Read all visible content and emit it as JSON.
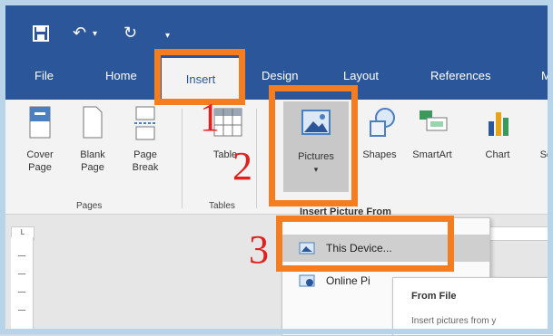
{
  "quick_access": {
    "save_icon": "save-icon",
    "undo_icon": "undo-icon",
    "redo_icon": "redo-icon",
    "customize_icon": "customize-qat-icon"
  },
  "tabs": [
    "File",
    "Home",
    "Insert",
    "Design",
    "Layout",
    "References",
    "M"
  ],
  "ribbon": {
    "pages": {
      "cover_page": "Cover Page",
      "blank_page": "Blank Page",
      "page_break": "Page Break",
      "group_label": "Pages"
    },
    "tables": {
      "table": "Table",
      "group_label": "Tables"
    },
    "illustrations": {
      "pictures": "Pictures",
      "shapes": "Shapes",
      "smartart": "SmartArt",
      "chart": "Chart",
      "screenshot": "Sc"
    }
  },
  "insert_picture_menu": {
    "title": "Insert Picture From",
    "items": [
      "This Device...",
      "Online Pi"
    ]
  },
  "tooltip": {
    "title": "From File",
    "body": "Insert pictures from y"
  },
  "annotations": {
    "step1": "1",
    "step2": "2",
    "step3": "3"
  },
  "ruler": {
    "corner_label": "L"
  },
  "colors": {
    "word_blue": "#2b579a",
    "highlight_orange": "#f47d20",
    "step_red": "#e0201c"
  }
}
